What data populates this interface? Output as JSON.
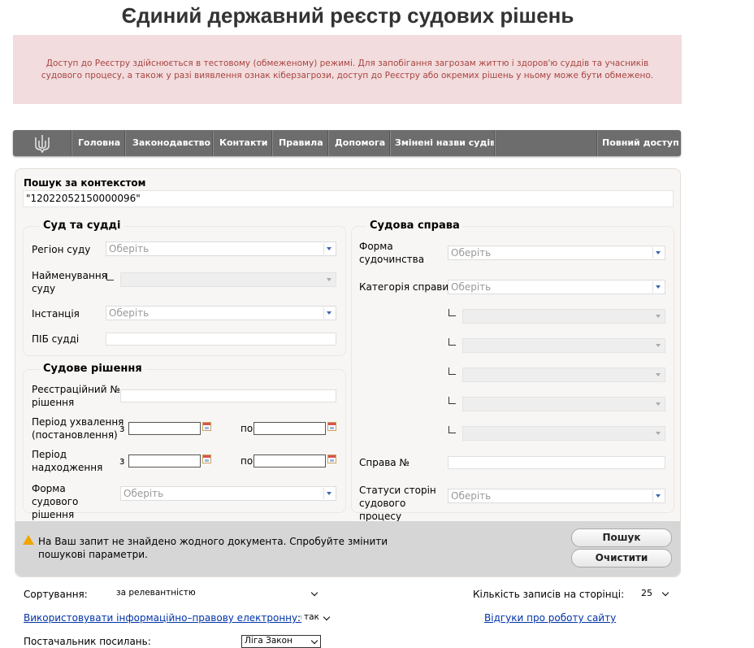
{
  "page_title": "Єдиний державний реєстр судових рішень",
  "notice": "Доступ до Реєстру здійснюється в тестовому (обмеженому) режимі. Для запобігання загрозам життю і здоров'ю суддів та учасників судового процесу, а також у разі виявлення ознак кіберзагрози, доступ до Реєстру або окремих рішень у ньому може бути обмежено.",
  "nav": {
    "items": [
      "Головна",
      "Законодавство",
      "Контакти",
      "Правила",
      "Допомога",
      "Змінені назви судів"
    ],
    "full_access": "Повний доступ"
  },
  "search": {
    "context_label": "Пошук за контекстом",
    "context_value": "\"12022052150000096\""
  },
  "court": {
    "legend": "Суд та судді",
    "region_label": "Регіон суду",
    "region_value": "Оберіть",
    "court_name_label": "Найменування суду",
    "instance_label": "Інстанція",
    "instance_value": "Оберіть",
    "judge_label": "ПІБ судді"
  },
  "decision": {
    "legend": "Судове рішення",
    "reg_number_label": "Реєстраційний № рішення",
    "period_adopted_label": "Період ухвалення (постановлення)",
    "period_received_label": "Період надходження",
    "from": "з",
    "to": "по",
    "form_label": "Форма судового рішення",
    "form_value": "Оберіть"
  },
  "case": {
    "legend": "Судова справа",
    "proceeding_form_label": "Форма судочинства",
    "proceeding_form_value": "Оберіть",
    "category_label": "Категорія справи",
    "category_value": "Оберіть",
    "case_number_label": "Справа №",
    "party_status_label": "Статуси сторін судового процесу",
    "party_status_value": "Оберіть"
  },
  "result_message": "На Ваш запит не знайдено жодного документа. Спробуйте змінити пошукові параметри.",
  "buttons": {
    "search": "Пошук",
    "clear": "Очистити"
  },
  "sorting": {
    "label": "Сортування:",
    "value": "за релевантністю"
  },
  "per_page": {
    "label": "Кількість записів на сторінці:",
    "value": "25"
  },
  "legal_base": {
    "link": "Використовувати інформаційно–правову електронну базу",
    "value": "так"
  },
  "feedback_link": "Відгуки про роботу сайту",
  "provider": {
    "label": "Постачальник посилань:",
    "value": "Ліга Закон"
  },
  "colors": {
    "nav_bg": "#6d6d6d",
    "notice_bg": "#f2dcdd",
    "notice_text": "#a94442",
    "link": "#0033aa"
  }
}
